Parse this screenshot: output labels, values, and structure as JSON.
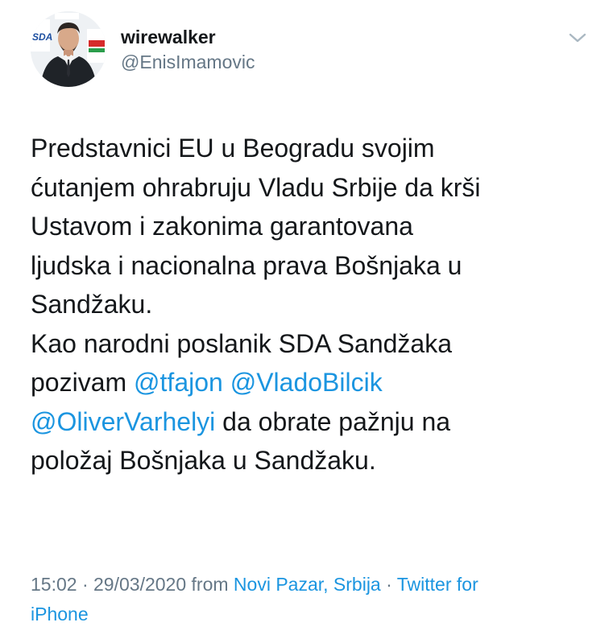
{
  "user": {
    "display_name": "wirewalker",
    "handle": "@EnisImamovic",
    "avatar_party_text": "SDA"
  },
  "tweet": {
    "lines": [
      [
        {
          "text": "Predstavnici EU u Beogradu svojim"
        }
      ],
      [
        {
          "text": "ćutanjem ohrabruju Vladu Srbije da krši"
        }
      ],
      [
        {
          "text": "Ustavom i zakonima garantovana"
        }
      ],
      [
        {
          "text": "ljudska i nacionalna prava Bošnjaka u"
        }
      ],
      [
        {
          "text": "Sandžaku."
        }
      ],
      [
        {
          "text": "Kao narodni poslanik SDA Sandžaka"
        }
      ],
      [
        {
          "text": "pozivam "
        },
        {
          "text": "@tfajon",
          "mention": true
        },
        {
          "text": " "
        },
        {
          "text": "@VladoBilcik",
          "mention": true
        }
      ],
      [
        {
          "text": "@OliverVarhelyi",
          "mention": true
        },
        {
          "text": " da obrate pažnju na"
        }
      ],
      [
        {
          "text": "položaj Bošnjaka u Sandžaku."
        }
      ]
    ]
  },
  "meta": {
    "time": "15:02",
    "separator_1": " · ",
    "date": "29/03/2020",
    "from_label": " from ",
    "location": "Novi Pazar, Srbija",
    "separator_2": " · ",
    "source_part1": "Twitter for",
    "source_part2": "iPhone"
  },
  "icons": {
    "more": "chevron-down-icon"
  },
  "colors": {
    "text": "#14171a",
    "secondary": "#657786",
    "link": "#1b95e0"
  }
}
